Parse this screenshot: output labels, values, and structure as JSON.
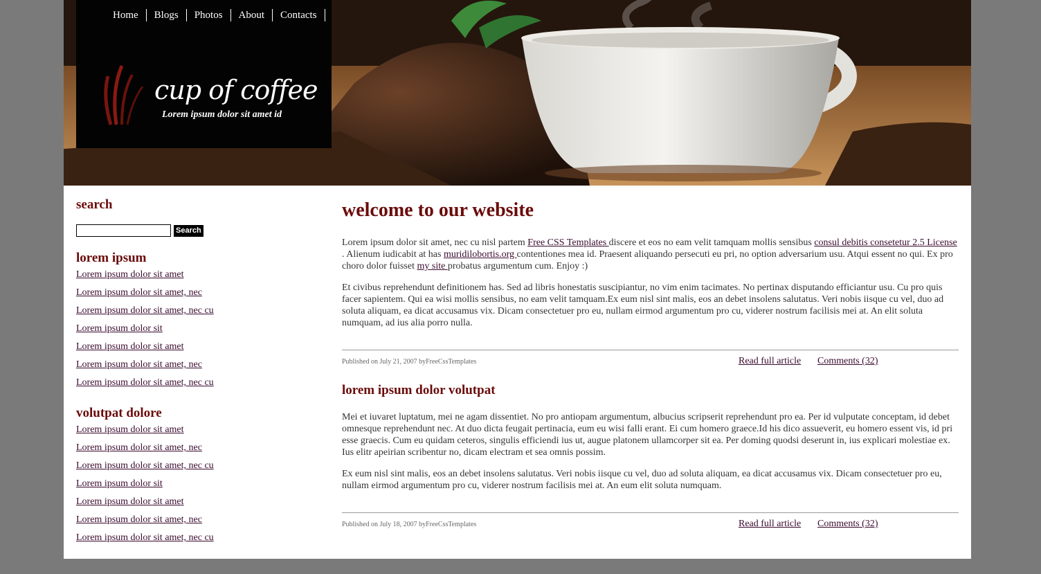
{
  "nav": {
    "items": [
      {
        "label": "Home"
      },
      {
        "label": "Blogs"
      },
      {
        "label": "Photos"
      },
      {
        "label": "About"
      },
      {
        "label": "Contacts"
      }
    ]
  },
  "logo": {
    "title": "cup of coffee",
    "tagline": "Lorem ipsum dolor sit amet id"
  },
  "sidebar": {
    "search_title": "search",
    "search_placeholder": "",
    "search_button": "Search",
    "section1_title": "lorem ipsum",
    "section1_links": [
      "Lorem ipsum dolor sit amet",
      "Lorem ipsum dolor sit amet, nec",
      "Lorem ipsum dolor sit amet, nec cu",
      "Lorem ipsum dolor sit",
      "Lorem ipsum dolor sit amet",
      "Lorem ipsum dolor sit amet, nec",
      "Lorem ipsum dolor sit amet, nec cu"
    ],
    "section2_title": "volutpat dolore",
    "section2_links": [
      "Lorem ipsum dolor sit amet",
      "Lorem ipsum dolor sit amet, nec",
      "Lorem ipsum dolor sit amet, nec cu",
      "Lorem ipsum dolor sit",
      "Lorem ipsum dolor sit amet",
      "Lorem ipsum dolor sit amet, nec",
      "Lorem ipsum dolor sit amet, nec cu"
    ]
  },
  "posts": [
    {
      "title": "welcome to our website",
      "p1_a": "Lorem ipsum dolor sit amet, nec cu nisl partem ",
      "p1_link1": "Free CSS Templates ",
      "p1_b": "discere et eos no eam velit tamquam mollis sensibus ",
      "p1_link2": "consul debitis consetetur 2.5 License ",
      "p1_c": ". Alienum iudicabit at has ",
      "p1_link3": "muridilobortis.org ",
      "p1_d": "contentiones mea id. Praesent aliquando persecuti eu pri, no option adversarium usu. Atqui essent no qui. Ex pro choro dolor fuisset ",
      "p1_link4": "my site ",
      "p1_e": "probatus argumentum cum. Enjoy :)",
      "p2": "Et civibus reprehendunt definitionem has. Sed ad libris honestatis suscipiantur, no vim enim tacimates. No pertinax disputando efficiantur usu. Cu pro quis facer sapientem. Qui ea wisi mollis sensibus, no eam velit tamquam.Ex eum nisl sint malis, eos an debet insolens salutatus. Veri nobis iisque cu vel, duo ad soluta aliquam, ea dicat accusamus vix. Dicam consectetuer pro eu, nullam eirmod argumentum pro cu, viderer nostrum facilisis mei at. An elit soluta numquam, ad ius alia porro nulla.",
      "meta_date": "Published on July 21, 2007 byFreeCssTemplates",
      "read_more": "Read full article ",
      "comments": "Comments (32)"
    },
    {
      "title": "lorem ipsum dolor volutpat",
      "p1": "Mei et iuvaret luptatum, mei ne agam dissentiet. No pro antiopam argumentum, albucius scripserit reprehendunt pro ea. Per id vulputate conceptam, id debet omnesque reprehendunt nec. At duo dicta feugait pertinacia, eum eu wisi falli erant. Ei cum homero graece.Id his dico assueverit, eu homero essent vis, id pri esse graecis. Cum eu quidam ceteros, singulis efficiendi ius ut, augue platonem ullamcorper sit ea. Per doming quodsi deserunt in, ius explicari molestiae ex. Ius elitr apeirian scribentur no, dicam electram et sea omnis possim.",
      "p2": "Ex eum nisl sint malis, eos an debet insolens salutatus. Veri nobis iisque cu vel, duo ad soluta aliquam, ea dicat accusamus vix. Dicam consectetuer pro eu, nullam eirmod argumentum pro cu, viderer nostrum facilisis mei at. An eum elit soluta numquam.",
      "meta_date": "Published on July 18, 2007 byFreeCssTemplates",
      "read_more": "Read full article ",
      "comments": "Comments (32)"
    }
  ]
}
